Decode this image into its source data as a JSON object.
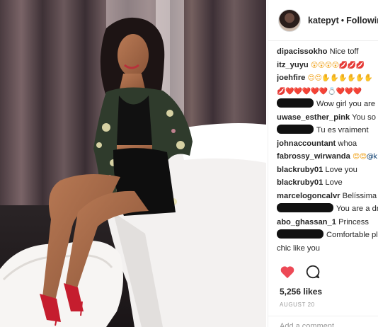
{
  "header": {
    "username": "katepyt",
    "separator": "•",
    "follow_status": "Following"
  },
  "comments": [
    {
      "user": "dipacissokho",
      "text": "Nice toff",
      "redacted": false
    },
    {
      "user": "itz_yuyu",
      "text": "😲😲😲😲💋💋💋",
      "redacted": false,
      "emoji": true
    },
    {
      "user": "joehfire",
      "text": "😍😍✋✋✋✋✋✋",
      "redacted": false,
      "emoji": true
    },
    {
      "user": "",
      "text": "💋❤️❤️❤️❤️❤️💍❤️❤️❤️",
      "redacted": false,
      "emoji": true
    },
    {
      "user": "",
      "text": "Wow girl you are",
      "redacted": true
    },
    {
      "user": "uwase_esther_pink",
      "text": "You so c",
      "redacted": false
    },
    {
      "user": "",
      "text": "Tu es vraiment",
      "redacted": true
    },
    {
      "user": "johnaccountant",
      "text": "whoa",
      "redacted": false
    },
    {
      "user": "fabrossy_wirwanda",
      "text": "😍😍@k",
      "redacted": false,
      "emoji": true
    },
    {
      "user": "blackruby01",
      "text": "Love you",
      "redacted": false
    },
    {
      "user": "blackruby01",
      "text": "Love",
      "redacted": false
    },
    {
      "user": "marcelogoncalvr",
      "text": "Belíssima",
      "redacted": false
    },
    {
      "user": "",
      "text": "You are a dr",
      "redacted": true
    },
    {
      "user": "abo_ghassan_1",
      "text": "Princess",
      "redacted": false
    },
    {
      "user": "",
      "text": "Comfortable pl",
      "redacted": true
    },
    {
      "user": "",
      "text": "chic like you",
      "redacted": false,
      "continuation": true
    }
  ],
  "actions": {
    "like_icon": "heart-icon",
    "comment_icon": "comment-bubble-icon",
    "like_color": "#ed4956"
  },
  "likes": "5,256 likes",
  "date": "AUGUST 20",
  "add_comment_placeholder": "Add a comment..."
}
